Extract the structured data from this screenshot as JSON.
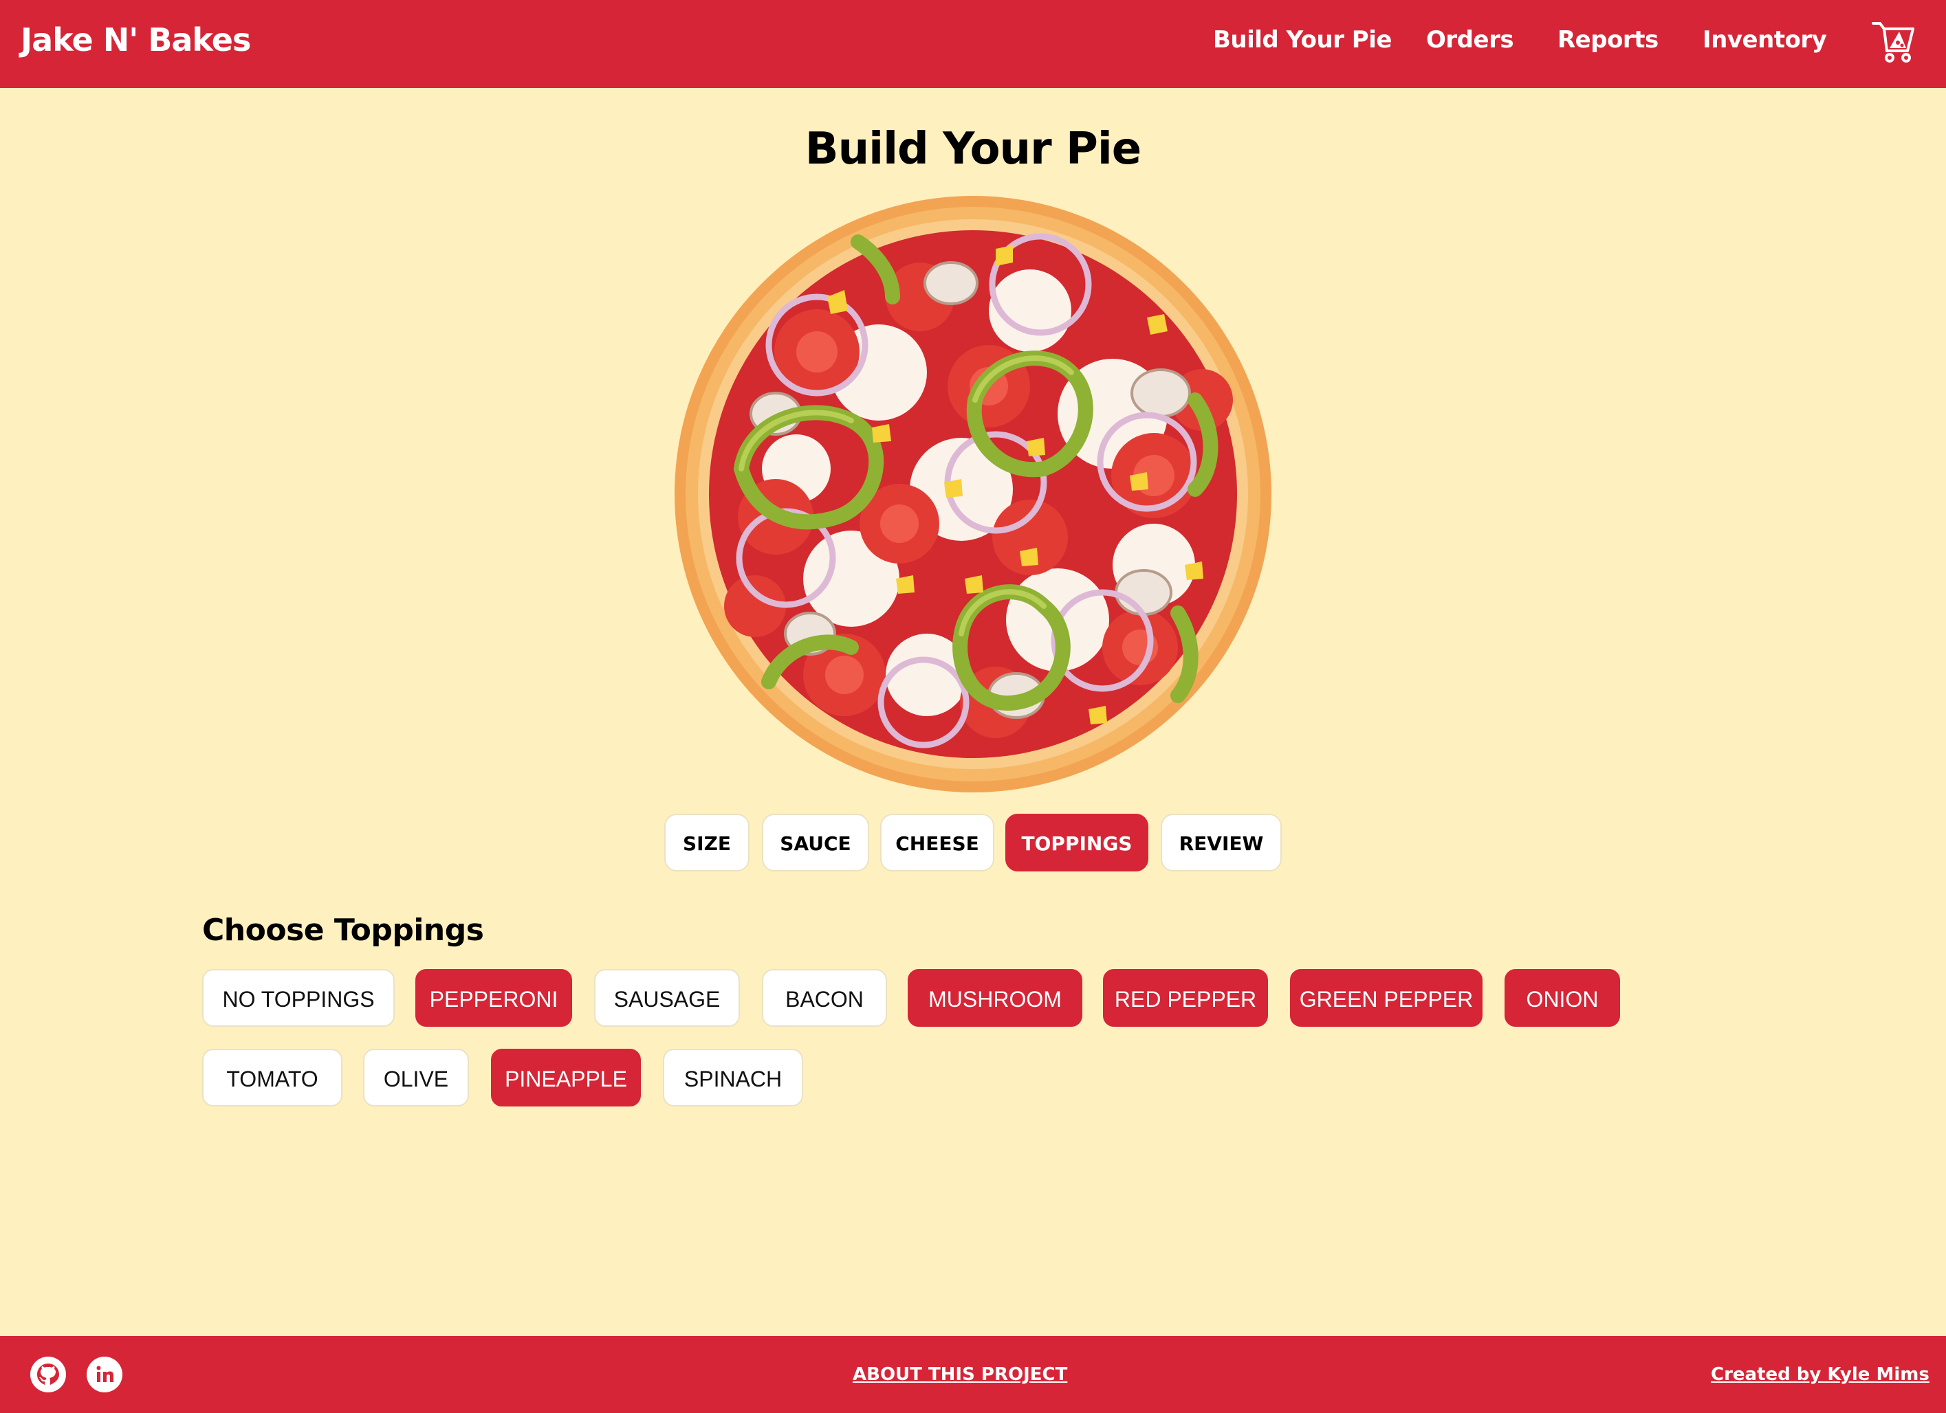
{
  "header": {
    "brand": "Jake N' Bakes",
    "nav": [
      {
        "label": "Build Your Pie"
      },
      {
        "label": "Orders"
      },
      {
        "label": "Reports"
      },
      {
        "label": "Inventory"
      }
    ],
    "cart_icon": "cart-icon"
  },
  "main": {
    "title": "Build Your Pie",
    "tabs": [
      {
        "label": "SIZE",
        "active": false
      },
      {
        "label": "SAUCE",
        "active": false
      },
      {
        "label": "CHEESE",
        "active": false
      },
      {
        "label": "TOPPINGS",
        "active": true
      },
      {
        "label": "REVIEW",
        "active": false
      }
    ],
    "toppings_heading": "Choose Toppings",
    "toppings": [
      {
        "label": "NO TOPPINGS",
        "selected": false
      },
      {
        "label": "PEPPERONI",
        "selected": true
      },
      {
        "label": "SAUSAGE",
        "selected": false
      },
      {
        "label": "BACON",
        "selected": false
      },
      {
        "label": "MUSHROOM",
        "selected": true
      },
      {
        "label": "RED PEPPER",
        "selected": true
      },
      {
        "label": "GREEN PEPPER",
        "selected": true
      },
      {
        "label": "ONION",
        "selected": true
      },
      {
        "label": "TOMATO",
        "selected": false
      },
      {
        "label": "OLIVE",
        "selected": false
      },
      {
        "label": "PINEAPPLE",
        "selected": true
      },
      {
        "label": "SPINACH",
        "selected": false
      }
    ]
  },
  "footer": {
    "icons": [
      "github-icon",
      "linkedin-icon"
    ],
    "about_label": "ABOUT THIS PROJECT",
    "credit_label": "Created by Kyle Mims"
  },
  "colors": {
    "brand_red": "#d62537",
    "page_bg": "#fff0bf",
    "chip_bg": "#ffffff"
  }
}
